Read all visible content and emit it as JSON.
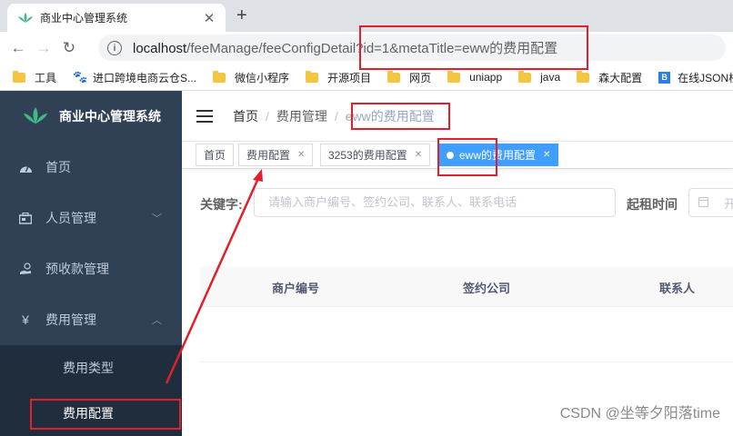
{
  "browser": {
    "tab_title": "商业中心管理系统",
    "url_host": "localhost",
    "url_path": "/feeManage/feeConfigDetail?id=1&metaTitle=eww的费用配置",
    "bookmarks": [
      "工具",
      "进口跨境电商云仓S...",
      "微信小程序",
      "开源项目",
      "网页",
      "uniapp",
      "java",
      "森大配置",
      "在线JSON校"
    ]
  },
  "sidebar": {
    "brand": "商业中心管理系统",
    "items": [
      {
        "label": "首页",
        "icon": "dashboard-icon"
      },
      {
        "label": "人员管理",
        "icon": "people-icon"
      },
      {
        "label": "预收款管理",
        "icon": "money-icon"
      },
      {
        "label": "费用管理",
        "icon": "yen-icon"
      }
    ],
    "submenu": [
      "费用类型",
      "费用配置"
    ]
  },
  "breadcrumb": [
    "首页",
    "费用管理",
    "eww的费用配置"
  ],
  "tags": [
    "首页",
    "费用配置",
    "3253的费用配置",
    "eww的费用配置"
  ],
  "filter": {
    "keyword_label": "关键字:",
    "keyword_placeholder": "请输入商户编号、签约公司、联系人、联系电话",
    "date_label": "起租时间",
    "date_placeholder": "开"
  },
  "table": {
    "headers": [
      "商户编号",
      "签约公司",
      "联系人"
    ]
  },
  "watermark": "CSDN @坐等夕阳落time",
  "colors": {
    "sidebar_bg": "#304156",
    "active_tag": "#409eff",
    "annotation": "#e0202a"
  }
}
